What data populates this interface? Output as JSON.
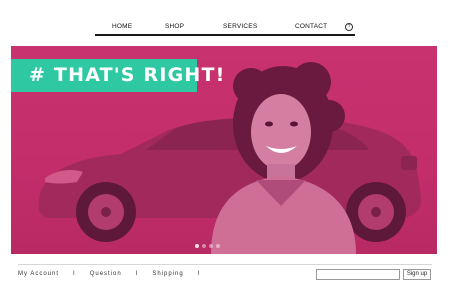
{
  "nav": {
    "items": [
      {
        "label": "HOME"
      },
      {
        "label": "SHOP"
      },
      {
        "label": "SERVICES"
      },
      {
        "label": "CONTACT"
      }
    ],
    "help_icon": "question-icon"
  },
  "hero": {
    "banner_text": "# THAT'S RIGHT!",
    "banner_color": "#2ec9a3",
    "tint_color": "#c8326f",
    "slides_total": 4,
    "slide_active": 1
  },
  "footer": {
    "links": [
      {
        "label": "My Account"
      },
      {
        "label": "Question"
      },
      {
        "label": "Shipping"
      }
    ],
    "separator": "I",
    "signup_label": "Sign up",
    "email_value": ""
  }
}
